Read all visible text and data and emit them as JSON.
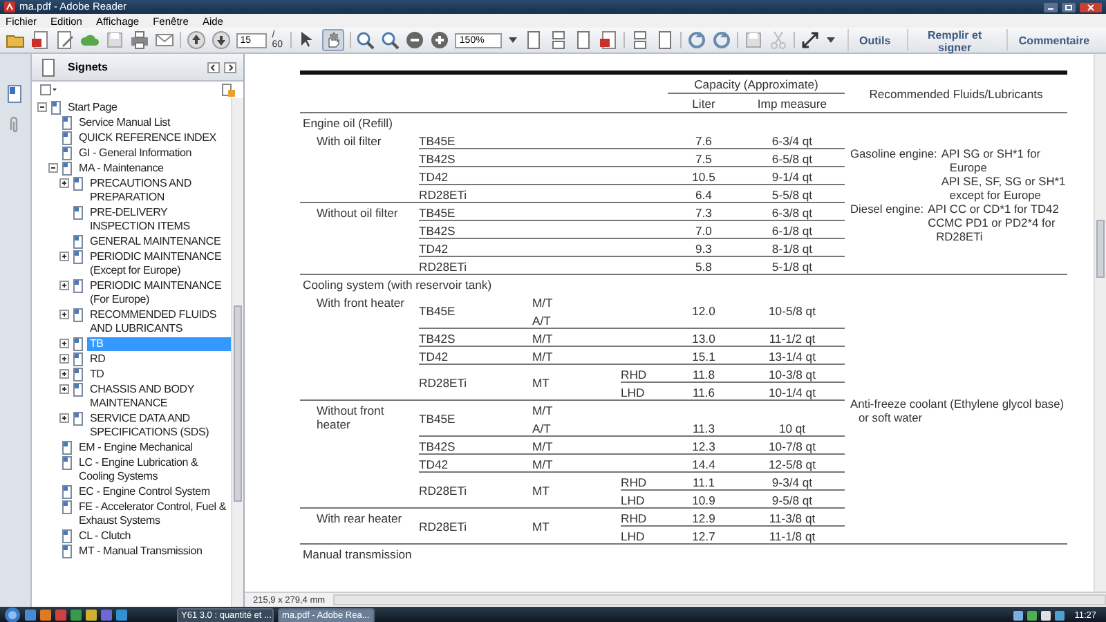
{
  "window": {
    "title": "ma.pdf - Adobe Reader"
  },
  "menu": [
    "Fichier",
    "Edition",
    "Affichage",
    "Fenêtre",
    "Aide"
  ],
  "toolbar": {
    "page": "15",
    "page_count": "/ 60",
    "zoom": "150%",
    "panels": [
      "Outils",
      "Remplir et signer",
      "Commentaire"
    ]
  },
  "sidebar": {
    "title": "Signets",
    "items": [
      {
        "label": "Start Page",
        "expanded": true,
        "selected": false,
        "children": [
          {
            "label": "Service Manual List",
            "selected": false
          },
          {
            "label": "QUICK REFERENCE INDEX",
            "selected": false
          },
          {
            "label": "GI - General Information",
            "selected": false
          },
          {
            "label": "MA - Maintenance",
            "expanded": true,
            "selected": false,
            "children": [
              {
                "label": "PRECAUTIONS AND PREPARATION",
                "expanded": false,
                "selected": false
              },
              {
                "label": "PRE-DELIVERY INSPECTION ITEMS",
                "selected": false
              },
              {
                "label": "GENERAL MAINTENANCE",
                "selected": false
              },
              {
                "label": "PERIODIC MAINTENANCE (Except for Europe)",
                "expanded": false,
                "selected": false
              },
              {
                "label": "PERIODIC MAINTENANCE (For Europe)",
                "expanded": false,
                "selected": false
              },
              {
                "label": "RECOMMENDED FLUIDS AND LUBRICANTS",
                "expanded": false,
                "selected": false
              },
              {
                "label": "TB",
                "expanded": false,
                "selected": true
              },
              {
                "label": "RD",
                "expanded": false,
                "selected": false
              },
              {
                "label": "TD",
                "expanded": false,
                "selected": false
              },
              {
                "label": "CHASSIS AND BODY MAINTENANCE",
                "expanded": false,
                "selected": false
              },
              {
                "label": "SERVICE DATA AND SPECIFICATIONS (SDS)",
                "expanded": false,
                "selected": false
              }
            ]
          },
          {
            "label": "EM - Engine Mechanical",
            "selected": false
          },
          {
            "label": "LC - Engine Lubrication & Cooling Systems",
            "selected": false
          },
          {
            "label": "EC - Engine Control System",
            "selected": false
          },
          {
            "label": "FE - Accelerator Control, Fuel & Exhaust Systems",
            "selected": false
          },
          {
            "label": "CL - Clutch",
            "selected": false
          },
          {
            "label": "MT - Manual Transmission",
            "selected": false
          }
        ]
      }
    ]
  },
  "document": {
    "header": {
      "capacity": "Capacity (Approximate)",
      "liter": "Liter",
      "imp": "Imp measure",
      "fluids": "Recommended Fluids/Lubricants"
    },
    "sections": [
      {
        "title": "Engine oil (Refill)",
        "groups": [
          {
            "label": "With oil filter",
            "models": [
              {
                "model": "TB45E",
                "liter": "7.6",
                "imp": "6-3/4 qt"
              },
              {
                "model": "TB42S",
                "liter": "7.5",
                "imp": "6-5/8 qt"
              },
              {
                "model": "TD42",
                "liter": "10.5",
                "imp": "9-1/4 qt"
              },
              {
                "model": "RD28ETi",
                "liter": "6.4",
                "imp": "5-5/8 qt"
              }
            ]
          },
          {
            "label": "Without oil filter",
            "models": [
              {
                "model": "TB45E",
                "liter": "7.3",
                "imp": "6-3/8 qt"
              },
              {
                "model": "TB42S",
                "liter": "7.0",
                "imp": "6-1/8 qt"
              },
              {
                "model": "TD42",
                "liter": "9.3",
                "imp": "8-1/8 qt"
              },
              {
                "model": "RD28ETi",
                "liter": "5.8",
                "imp": "5-1/8 qt"
              }
            ]
          }
        ],
        "fluids": [
          {
            "label": "Gasoline engine:",
            "lines": [
              "API SG or SH*1 for Europe",
              "API SE, SF, SG or SH*1 except for Europe"
            ]
          },
          {
            "label": "Diesel engine:",
            "lines": [
              "API CC or CD*1 for TD42",
              "CCMC PD1 or PD2*4 for RD28ETi"
            ]
          }
        ]
      },
      {
        "title": "Cooling system (with reservoir tank)",
        "groups": [
          {
            "label": "With front heater",
            "models": [
              {
                "model": "TB45E",
                "liter": "12.0",
                "imp": "10-5/8 qt",
                "lines": [
                  {
                    "trans": "M/T"
                  },
                  {
                    "trans": "A/T"
                  }
                ]
              },
              {
                "model": "TB42S",
                "trans": "M/T",
                "liter": "13.0",
                "imp": "11-1/2 qt"
              },
              {
                "model": "TD42",
                "trans": "M/T",
                "liter": "15.1",
                "imp": "13-1/4 qt"
              },
              {
                "model": "RD28ETi",
                "trans": "MT",
                "lines": [
                  {
                    "hand": "RHD",
                    "liter": "11.8",
                    "imp": "10-3/8 qt"
                  },
                  {
                    "hand": "LHD",
                    "liter": "11.6",
                    "imp": "10-1/4 qt"
                  }
                ]
              }
            ]
          },
          {
            "label": "Without front heater",
            "models": [
              {
                "model": "TB45E",
                "lines": [
                  {
                    "trans": "M/T"
                  },
                  {
                    "trans": "A/T",
                    "liter": "11.3",
                    "imp": "10 qt"
                  }
                ]
              },
              {
                "model": "TB42S",
                "trans": "M/T",
                "liter": "12.3",
                "imp": "10-7/8 qt"
              },
              {
                "model": "TD42",
                "trans": "M/T",
                "liter": "14.4",
                "imp": "12-5/8 qt"
              },
              {
                "model": "RD28ETi",
                "trans": "MT",
                "lines": [
                  {
                    "hand": "RHD",
                    "liter": "11.1",
                    "imp": "9-3/4 qt"
                  },
                  {
                    "hand": "LHD",
                    "liter": "10.9",
                    "imp": "9-5/8 qt"
                  }
                ]
              }
            ]
          },
          {
            "label": "With rear heater",
            "models": [
              {
                "model": "RD28ETi",
                "trans": "MT",
                "lines": [
                  {
                    "hand": "RHD",
                    "liter": "12.9",
                    "imp": "11-3/8 qt"
                  },
                  {
                    "hand": "LHD",
                    "liter": "12.7",
                    "imp": "11-1/8 qt"
                  }
                ]
              }
            ]
          }
        ],
        "fluids": [
          {
            "lines": [
              "Anti-freeze coolant (Ethylene glycol base) or soft water"
            ]
          }
        ]
      }
    ],
    "next_section": "Manual transmission"
  },
  "status_bar": {
    "page_size": "215,9 x 279,4 mm"
  },
  "taskbar": {
    "items": [
      {
        "label": "Y61 3.0 : quantité et ...",
        "selected": false
      },
      {
        "label": "ma.pdf - Adobe Rea...",
        "selected": true
      }
    ],
    "clock": "11:27"
  }
}
